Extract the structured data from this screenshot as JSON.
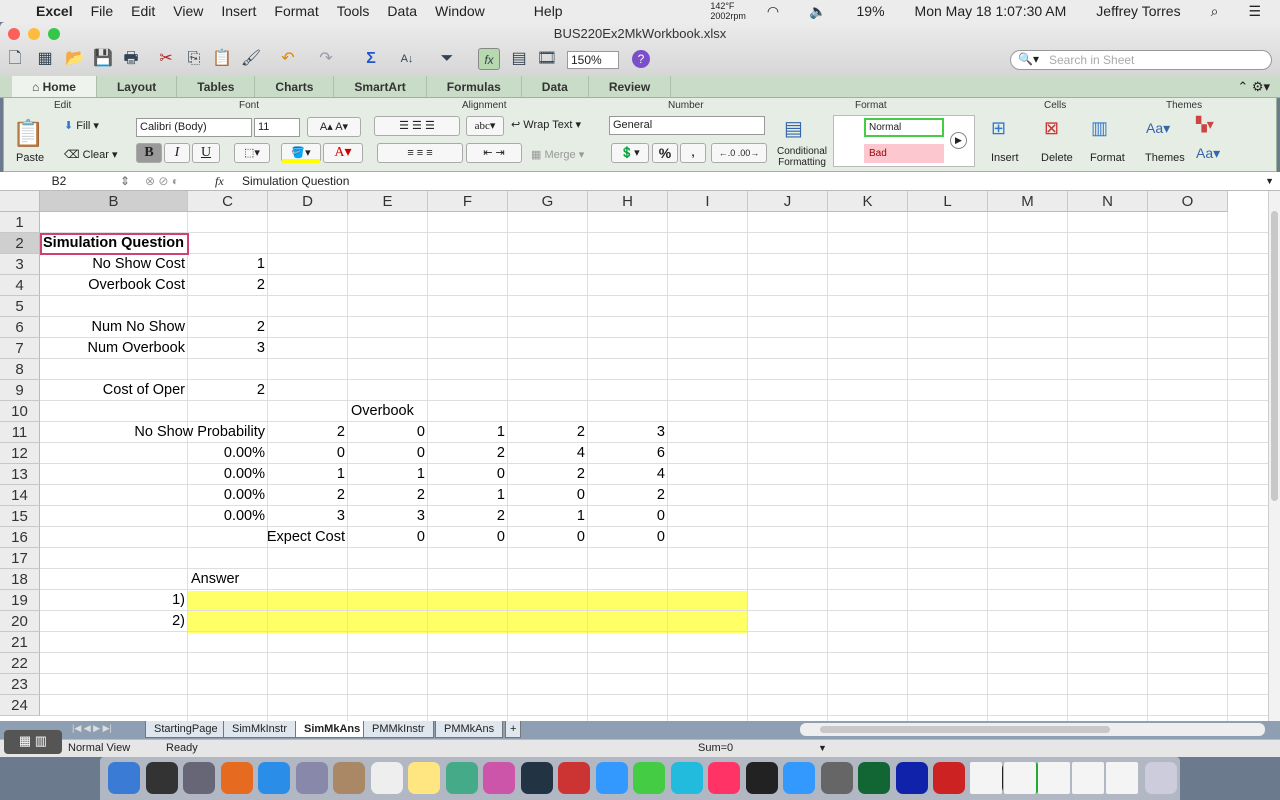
{
  "menubar": {
    "app": "Excel",
    "items": [
      "File",
      "Edit",
      "View",
      "Insert",
      "Format",
      "Tools",
      "Data",
      "Window",
      "Help"
    ],
    "temp": "142°F",
    "rpm": "2002rpm",
    "battery": "19%",
    "datetime": "Mon May 18  1:07:30 AM",
    "user": "Jeffrey Torres"
  },
  "window": {
    "title": "BUS220Ex2MkWorkbook.xlsx",
    "zoom": "150%",
    "search_placeholder": "Search in Sheet"
  },
  "ribbon_tabs": [
    "Home",
    "Layout",
    "Tables",
    "Charts",
    "SmartArt",
    "Formulas",
    "Data",
    "Review"
  ],
  "ribbon": {
    "groups": {
      "edit": "Edit",
      "font": "Font",
      "alignment": "Alignment",
      "number": "Number",
      "format": "Format",
      "cells": "Cells",
      "themes": "Themes"
    },
    "paste": "Paste",
    "fill": "Fill",
    "clear": "Clear",
    "font_name": "Calibri (Body)",
    "font_size": "11",
    "bold": "B",
    "italic": "I",
    "underline": "U",
    "wrap_text": "Wrap Text",
    "merge": "Merge",
    "abc": "abc",
    "number_format": "General",
    "percent": "%",
    "comma": ",",
    "cond_format": "Conditional Formatting",
    "style_normal": "Normal",
    "style_bad": "Bad",
    "insert": "Insert",
    "delete": "Delete",
    "format": "Format",
    "themes": "Themes"
  },
  "formula_bar": {
    "cell_ref": "B2",
    "fx": "fx",
    "content": "Simulation Question"
  },
  "columns": [
    "B",
    "C",
    "D",
    "E",
    "F",
    "G",
    "H",
    "I",
    "J",
    "K",
    "L",
    "M",
    "N",
    "O"
  ],
  "rows": [
    "1",
    "2",
    "3",
    "4",
    "5",
    "6",
    "7",
    "8",
    "9",
    "10",
    "11",
    "12",
    "13",
    "14",
    "15",
    "16",
    "17",
    "18",
    "19",
    "20",
    "21",
    "22",
    "23",
    "24"
  ],
  "cells": [
    {
      "ref": "B2",
      "v": "Simulation Question",
      "bold": true
    },
    {
      "ref": "B3",
      "v": "No Show Cost"
    },
    {
      "ref": "C3",
      "v": "1"
    },
    {
      "ref": "B4",
      "v": "Overbook Cost"
    },
    {
      "ref": "C4",
      "v": "2"
    },
    {
      "ref": "B6",
      "v": "Num No Show"
    },
    {
      "ref": "C6",
      "v": "2"
    },
    {
      "ref": "B7",
      "v": "Num Overbook"
    },
    {
      "ref": "C7",
      "v": "3"
    },
    {
      "ref": "B9",
      "v": "Cost of Oper"
    },
    {
      "ref": "C9",
      "v": "2"
    },
    {
      "ref": "E10",
      "v": "Overbook"
    },
    {
      "ref": "C11",
      "v": "No Show Probability"
    },
    {
      "ref": "D11",
      "v": "2"
    },
    {
      "ref": "E11",
      "v": "0"
    },
    {
      "ref": "F11",
      "v": "1"
    },
    {
      "ref": "G11",
      "v": "2"
    },
    {
      "ref": "H11",
      "v": "3"
    },
    {
      "ref": "C12",
      "v": "0.00%"
    },
    {
      "ref": "D12",
      "v": "0"
    },
    {
      "ref": "E12",
      "v": "0"
    },
    {
      "ref": "F12",
      "v": "2"
    },
    {
      "ref": "G12",
      "v": "4"
    },
    {
      "ref": "H12",
      "v": "6"
    },
    {
      "ref": "C13",
      "v": "0.00%"
    },
    {
      "ref": "D13",
      "v": "1"
    },
    {
      "ref": "E13",
      "v": "1"
    },
    {
      "ref": "F13",
      "v": "0"
    },
    {
      "ref": "G13",
      "v": "2"
    },
    {
      "ref": "H13",
      "v": "4"
    },
    {
      "ref": "C14",
      "v": "0.00%"
    },
    {
      "ref": "D14",
      "v": "2"
    },
    {
      "ref": "E14",
      "v": "2"
    },
    {
      "ref": "F14",
      "v": "1"
    },
    {
      "ref": "G14",
      "v": "0"
    },
    {
      "ref": "H14",
      "v": "2"
    },
    {
      "ref": "C15",
      "v": "0.00%"
    },
    {
      "ref": "D15",
      "v": "3"
    },
    {
      "ref": "E15",
      "v": "3"
    },
    {
      "ref": "F15",
      "v": "2"
    },
    {
      "ref": "G15",
      "v": "1"
    },
    {
      "ref": "H15",
      "v": "0"
    },
    {
      "ref": "D16",
      "v": "Expect Cost"
    },
    {
      "ref": "E16",
      "v": "0"
    },
    {
      "ref": "F16",
      "v": "0"
    },
    {
      "ref": "G16",
      "v": "0"
    },
    {
      "ref": "H16",
      "v": "0"
    },
    {
      "ref": "C18",
      "v": "Answer"
    },
    {
      "ref": "B19",
      "v": "1)"
    },
    {
      "ref": "B20",
      "v": "2)"
    }
  ],
  "highlight_color": "#ffff66",
  "sheet_tabs": [
    "StartingPage",
    "SimMkInstr",
    "SimMkAns",
    "PMMkInstr",
    "PMMkAns"
  ],
  "active_sheet": "SimMkAns",
  "status": {
    "view": "Normal View",
    "state": "Ready",
    "sum": "Sum=0"
  }
}
